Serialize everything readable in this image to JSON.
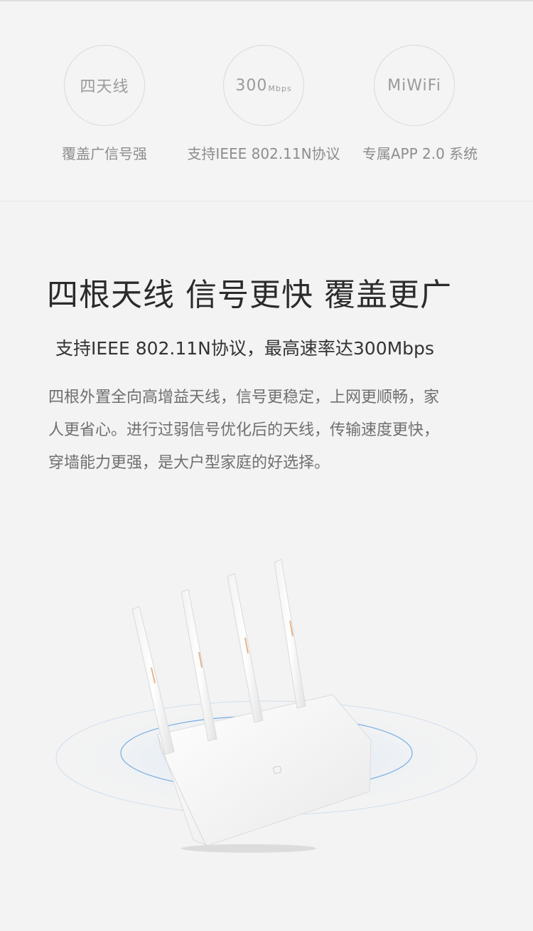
{
  "features": [
    {
      "circle_text": "四天线",
      "circle_suffix": "",
      "caption": "覆盖广信号强"
    },
    {
      "circle_text": "300",
      "circle_suffix": "Mbps",
      "caption": "支持IEEE 802.11N协议"
    },
    {
      "circle_text": "MiWiFi",
      "circle_suffix": "",
      "caption": "专属APP 2.0 系统"
    }
  ],
  "headline": "四根天线 信号更快 覆盖更广",
  "subheadline": "支持IEEE 802.11N协议，最高速率达300Mbps",
  "description_lines": [
    "四根外置全向高增益天线，信号更稳定，上网更顺畅，家",
    "人更省心。进行过弱信号优化后的天线，传输速度更快，",
    "穿墙能力更强，是大户型家庭的好选择。"
  ],
  "colors": {
    "background": "#f3f3f3",
    "headline": "#2b2b2b",
    "body_text": "#6f6f6f",
    "circle_border": "#d9d9d9",
    "antenna_accent": "#e8b48a",
    "signal_ring": "#5a9be0"
  },
  "icons": [
    "router-image",
    "mi-logo-icon"
  ]
}
